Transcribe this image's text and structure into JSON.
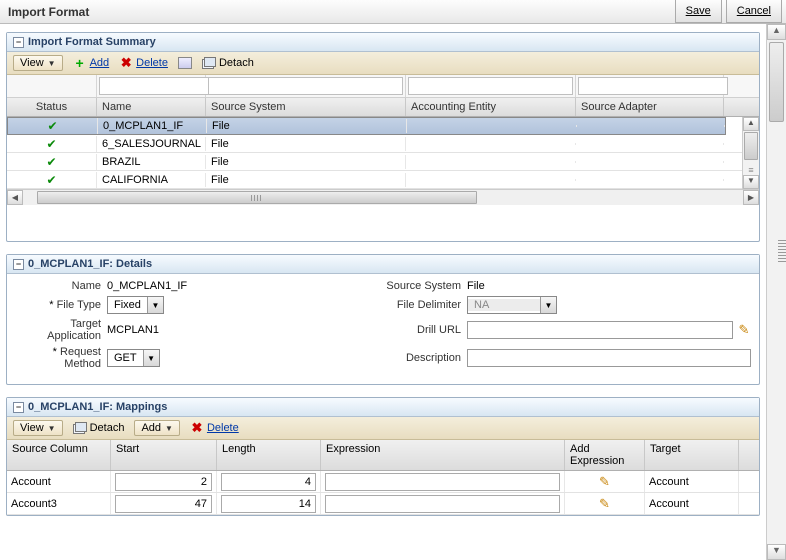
{
  "title": "Import Format",
  "buttons": {
    "save": "Save",
    "cancel": "Cancel"
  },
  "summary": {
    "header": "Import Format Summary",
    "toolbar": {
      "view": "View",
      "add": "Add",
      "delete": "Delete",
      "detach": "Detach"
    },
    "columns": {
      "status": "Status",
      "name": "Name",
      "source_system": "Source System",
      "accounting_entity": "Accounting Entity",
      "source_adapter": "Source Adapter"
    },
    "rows": [
      {
        "name": "0_MCPLAN1_IF",
        "source_system": "File",
        "accounting_entity": "",
        "source_adapter": ""
      },
      {
        "name": "6_SALESJOURNAL",
        "source_system": "File",
        "accounting_entity": "",
        "source_adapter": ""
      },
      {
        "name": "BRAZIL",
        "source_system": "File",
        "accounting_entity": "",
        "source_adapter": ""
      },
      {
        "name": "CALIFORNIA",
        "source_system": "File",
        "accounting_entity": "",
        "source_adapter": ""
      }
    ]
  },
  "details": {
    "header": "0_MCPLAN1_IF: Details",
    "labels": {
      "name": "Name",
      "file_type": "File Type",
      "target_app": "Target Application",
      "request_method": "Request Method",
      "source_system": "Source System",
      "file_delimiter": "File Delimiter",
      "drill_url": "Drill URL",
      "description": "Description"
    },
    "values": {
      "name": "0_MCPLAN1_IF",
      "file_type": "Fixed",
      "target_app": "MCPLAN1",
      "request_method": "GET",
      "source_system": "File",
      "file_delimiter": "NA",
      "drill_url": "",
      "description": ""
    }
  },
  "mappings": {
    "header": "0_MCPLAN1_IF: Mappings",
    "toolbar": {
      "view": "View",
      "detach": "Detach",
      "add": "Add",
      "delete": "Delete"
    },
    "columns": {
      "source_column": "Source Column",
      "start": "Start",
      "length": "Length",
      "expression": "Expression",
      "add_expression": "Add Expression",
      "target": "Target"
    },
    "rows": [
      {
        "source_column": "Account",
        "start": "2",
        "length": "4",
        "expression": "",
        "target": "Account"
      },
      {
        "source_column": "Account3",
        "start": "47",
        "length": "14",
        "expression": "",
        "target": "Account"
      }
    ]
  }
}
